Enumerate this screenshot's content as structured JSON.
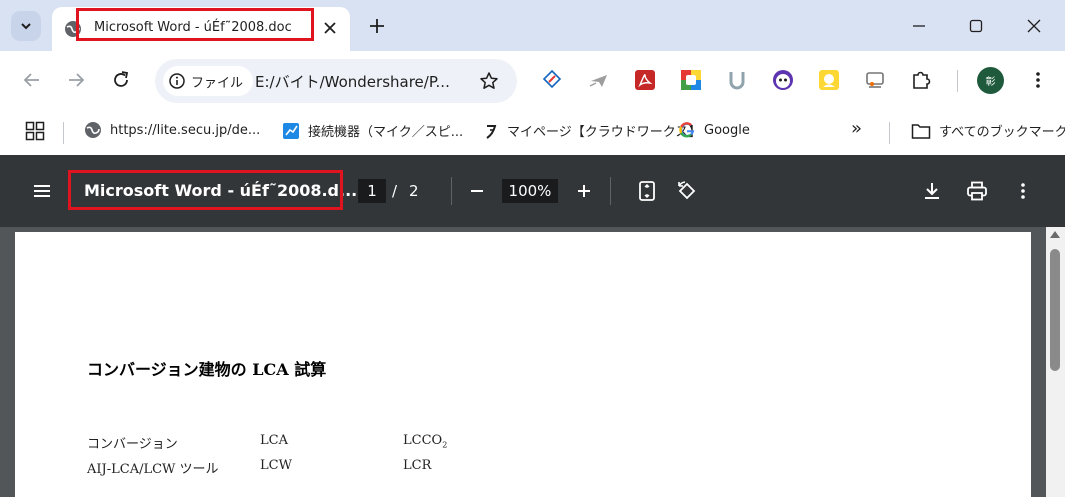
{
  "browser": {
    "tab": {
      "title": "Microsoft Word - úÉf˜2008.doc"
    },
    "omnibox": {
      "chip_label": "ファイル",
      "url": "E:/バイト/Wondershare/P..."
    },
    "bookmarks": [
      {
        "label": "https://lite.secu.jp/de...",
        "icon": "globe-icon"
      },
      {
        "label": "接続機器（マイク／スピ...",
        "icon": "chart-icon"
      },
      {
        "label": "マイページ【クラウドワークス】",
        "icon": "crowdworks-icon"
      },
      {
        "label": "Google",
        "icon": "google-icon"
      }
    ],
    "all_bookmarks_label": "すべてのブックマーク",
    "overflow_label": "»",
    "profile_initial": "彰",
    "extensions": [
      "ext-code-icon",
      "ext-plane-icon",
      "pdf-icon",
      "ext-color-icon",
      "ext-u-icon",
      "ext-face-icon",
      "ext-chat-icon",
      "ext-cast-icon",
      "puzzle-icon"
    ]
  },
  "pdf_viewer": {
    "title": "Microsoft Word - úÉf˜2008.d...",
    "current_page": "1",
    "page_separator": "/",
    "total_pages": "2",
    "zoom": "100%"
  },
  "document": {
    "heading": "コンバージョン建物の LCA 試算",
    "rows": [
      {
        "c1": "コンバージョン",
        "c2": "LCA",
        "c3": "LCCO",
        "c3_sub": "2"
      },
      {
        "c1": "AIJ-LCA/LCW ツール",
        "c2": "LCW",
        "c3": "LCR",
        "c3_sub": ""
      }
    ]
  },
  "colors": {
    "highlight": "#e0141e",
    "tabstrip": "#d9e2f3",
    "pdf_toolbar": "#323639",
    "pdf_background": "#525659"
  }
}
